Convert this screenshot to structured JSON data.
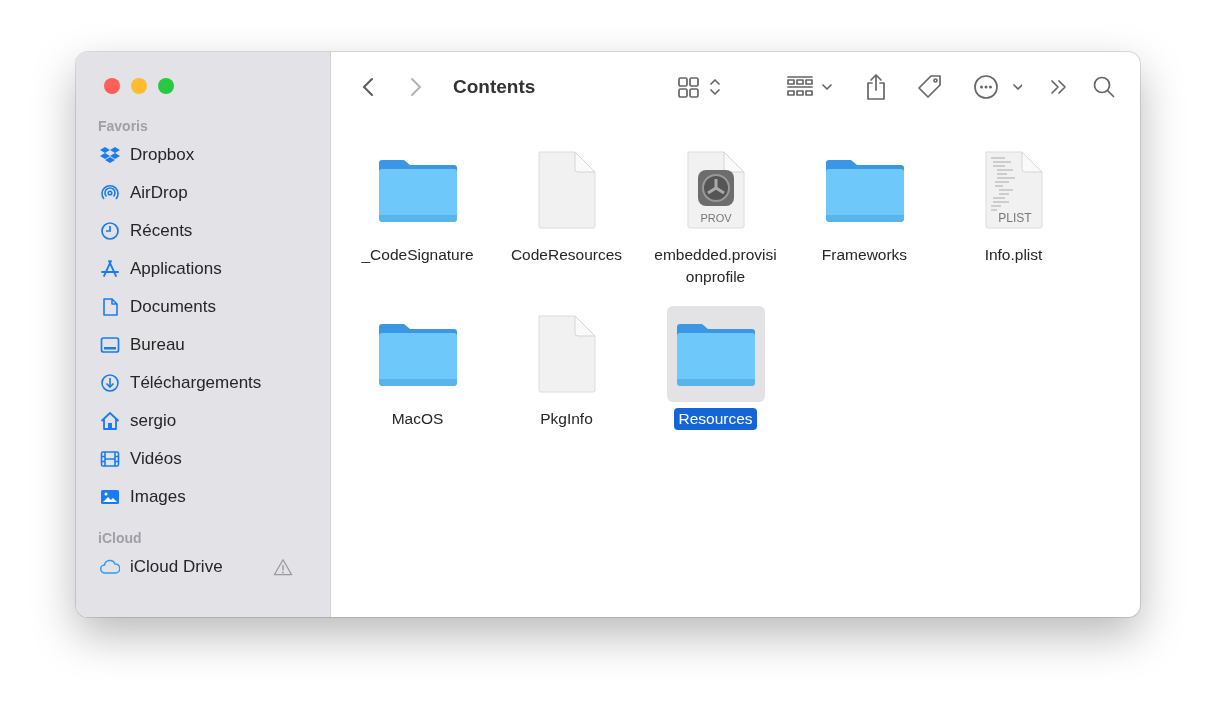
{
  "window": {
    "title": "Contents"
  },
  "navigation": {
    "back": {
      "disabled": false
    },
    "forward": {
      "disabled": true
    }
  },
  "sidebar": {
    "sections": [
      {
        "title": "Favoris",
        "items": [
          {
            "label": "Dropbox",
            "warning": false
          },
          {
            "label": "AirDrop",
            "warning": false
          },
          {
            "label": "Récents",
            "warning": false
          },
          {
            "label": "Applications",
            "warning": false
          },
          {
            "label": "Documents",
            "warning": false
          },
          {
            "label": "Bureau",
            "warning": false
          },
          {
            "label": "Téléchargements",
            "warning": false
          },
          {
            "label": "sergio",
            "warning": false
          },
          {
            "label": "Vidéos",
            "warning": false
          },
          {
            "label": "Images",
            "warning": false
          }
        ]
      },
      {
        "title": "iCloud",
        "items": [
          {
            "label": "iCloud Drive",
            "warning": true
          }
        ]
      }
    ]
  },
  "files": [
    {
      "name": "_CodeSignature",
      "kind": "folder",
      "selected": false
    },
    {
      "name": "CodeResources",
      "kind": "document",
      "selected": false
    },
    {
      "name": "embedded.provisionprofile",
      "kind": "badge-document",
      "badge": "PROV",
      "selected": false
    },
    {
      "name": "Frameworks",
      "kind": "folder",
      "selected": false
    },
    {
      "name": "Info.plist",
      "kind": "plist-document",
      "badge": "PLIST",
      "selected": false
    },
    {
      "name": "MacOS",
      "kind": "folder",
      "selected": false
    },
    {
      "name": "PkgInfo",
      "kind": "document",
      "selected": false
    },
    {
      "name": "Resources",
      "kind": "folder",
      "selected": true
    }
  ]
}
